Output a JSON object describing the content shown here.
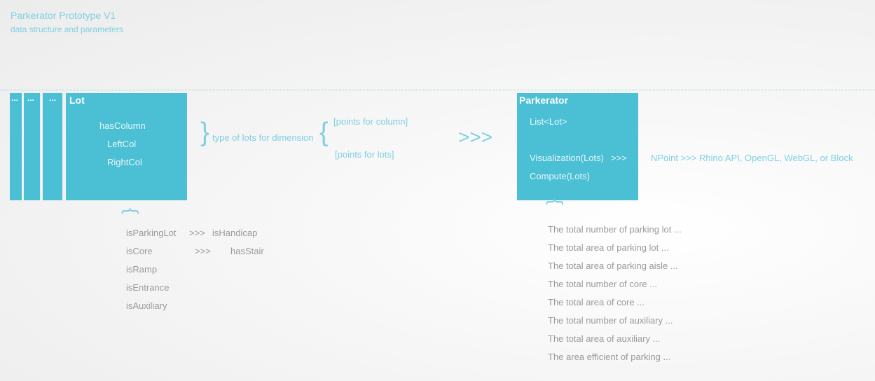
{
  "header": {
    "title": "Parkerator Prototype V1",
    "subtitle": "data structure and parameters"
  },
  "colors": {
    "accent": "#4bbfd3",
    "text_light": "#7fd0e2",
    "text_gray": "#9a9a9a"
  },
  "lot": {
    "stack_labels": [
      "...",
      "...",
      "..."
    ],
    "title": "Lot",
    "fields": [
      "hasColumn",
      "LeftCol",
      "RightCol"
    ],
    "brace_label": "type of lots for dimension",
    "dimension_items": [
      "[points for column]",
      "[points for lots]"
    ],
    "types": [
      {
        "name": "isParkingLot",
        "arrow": ">>>",
        "sub": "isHandicap"
      },
      {
        "name": "isCore",
        "arrow": ">>>",
        "sub": "hasStair"
      },
      {
        "name": "isRamp"
      },
      {
        "name": "isEntrance"
      },
      {
        "name": "isAuxiliary"
      }
    ]
  },
  "flow_arrow": ">>>",
  "parkerator": {
    "title": "Parkerator",
    "list": "List<Lot>",
    "visualization": "Visualization(Lots)",
    "vis_arrow": ">>>",
    "compute": "Compute(Lots)",
    "output": "NPoint >>> Rhino API, OpenGL, WebGL, or Block",
    "results": [
      "The total number of parking lot ...",
      "The total area of parking lot ...",
      "The total area of parking aisle ...",
      "The total number of core ...",
      "The total area of core ...",
      "The total number of auxiliary ...",
      "The total area of auxiliary ...",
      "The area efficient of parking ..."
    ]
  }
}
